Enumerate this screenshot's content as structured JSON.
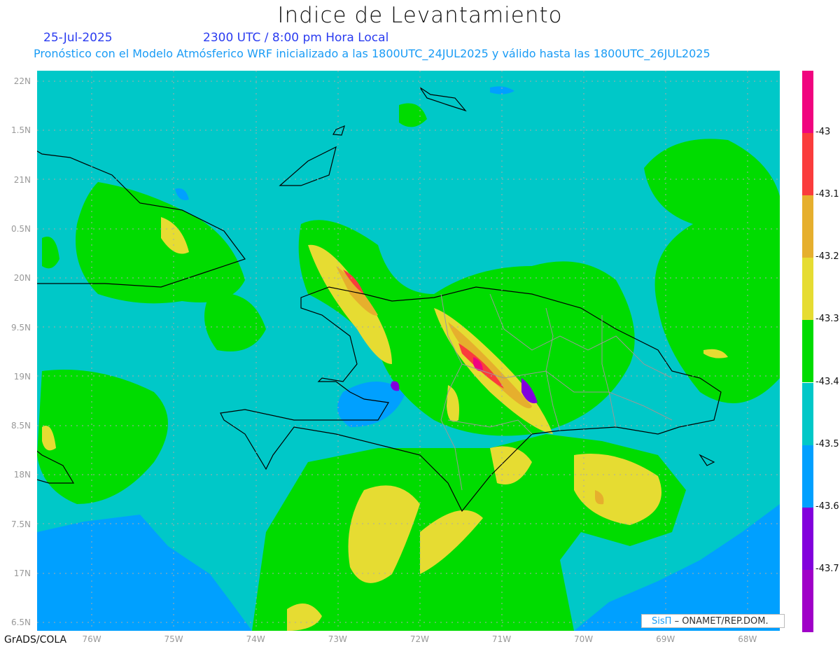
{
  "title": "Indice de Levantamiento",
  "date": "25-Jul-2025",
  "time": "2300 UTC / 8:00 pm Hora Local",
  "subtitle": "Pronóstico con el Modelo Atmósferico WRF inicializado a las 1800UTC_24JUL2025 y válido hasta las  1800UTC_26JUL2025",
  "footer_left": "GrADS/COLA",
  "credit": {
    "logo": "SisΠ",
    "text": "– ONAMET/REP.DOM."
  },
  "lat_labels": [
    "22N",
    "1.5N",
    "21N",
    "0.5N",
    "20N",
    "9.5N",
    "19N",
    "8.5N",
    "18N",
    "7.5N",
    "17N",
    "6.5N"
  ],
  "lon_labels": [
    "76W",
    "75W",
    "74W",
    "73W",
    "72W",
    "71W",
    "70W",
    "69W",
    "68W"
  ],
  "colorbar": {
    "colors": [
      "#f0047f",
      "#fa3c3c",
      "#e6af2d",
      "#e6dc32",
      "#00dc00",
      "#00c8c8",
      "#00a0ff",
      "#8200dc",
      "#a000c8"
    ],
    "labels": [
      "-43",
      "-43.1",
      "-43.2",
      "-43.3",
      "-43.4",
      "-43.5",
      "-43.6",
      "-43.7"
    ]
  }
}
